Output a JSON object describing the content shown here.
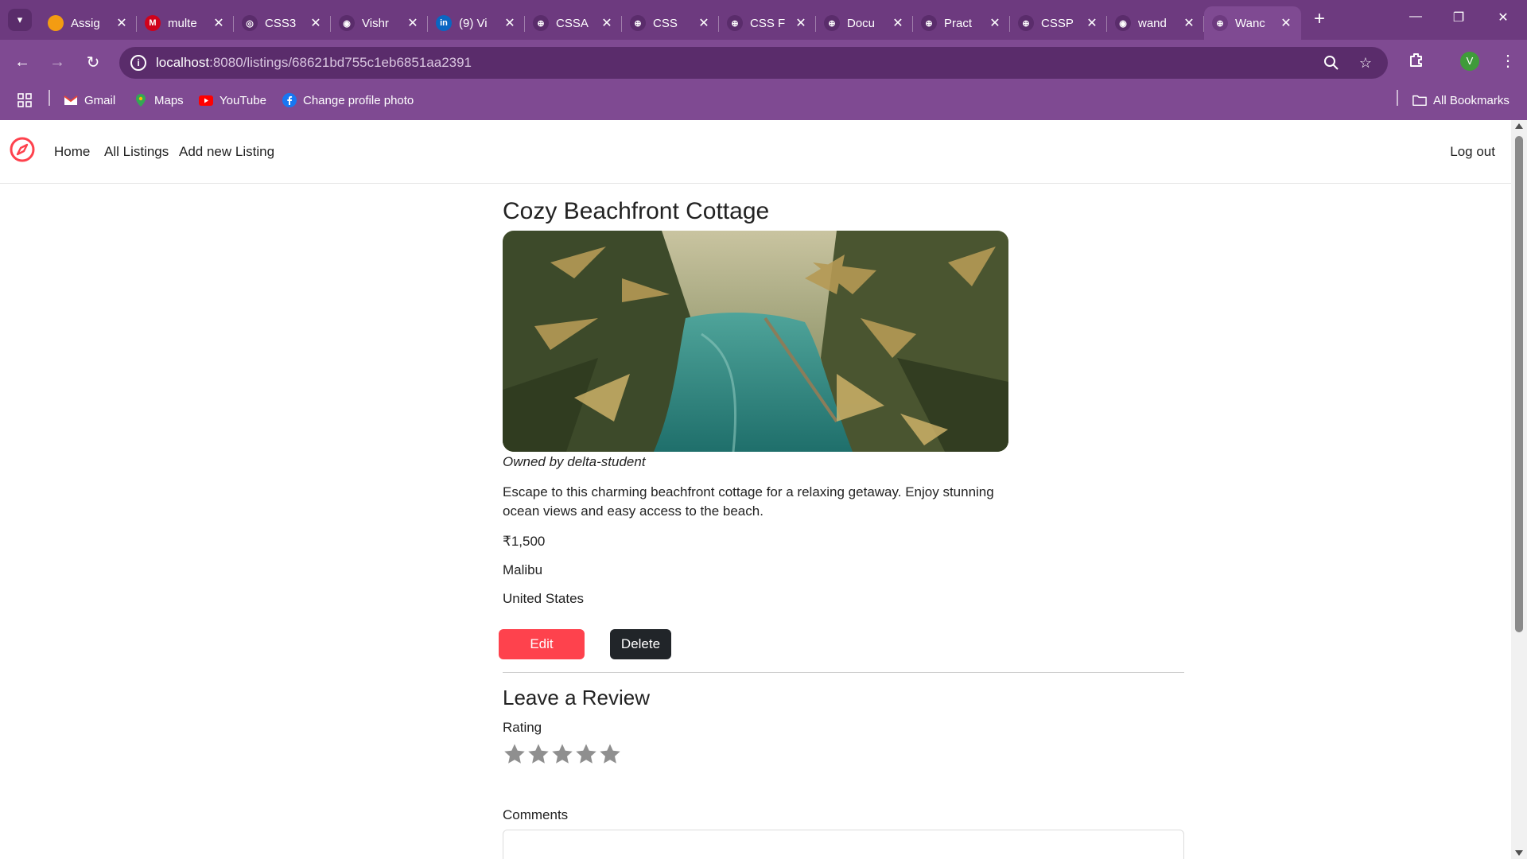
{
  "browser": {
    "tabs": [
      {
        "title": "Assig",
        "favicon": "assignment-icon",
        "fav_text": "",
        "fav_color": "#f39c12"
      },
      {
        "title": "multe",
        "favicon": "multe-icon",
        "fav_text": "M",
        "fav_color": "#d0021b"
      },
      {
        "title": "CSS3",
        "favicon": "chatgpt-icon",
        "fav_text": "◎",
        "fav_color": "#5a2c6b"
      },
      {
        "title": "Vishr",
        "favicon": "github-icon",
        "fav_text": "◉",
        "fav_color": "#5a2c6b"
      },
      {
        "title": "(9) Vi",
        "favicon": "linkedin-icon",
        "fav_text": "in",
        "fav_color": "#0a66c2"
      },
      {
        "title": "CSSA",
        "favicon": "globe-icon",
        "fav_text": "⊕",
        "fav_color": "#5a2c6b"
      },
      {
        "title": "CSS",
        "favicon": "globe-icon",
        "fav_text": "⊕",
        "fav_color": "#5a2c6b"
      },
      {
        "title": "CSS F",
        "favicon": "globe-icon",
        "fav_text": "⊕",
        "fav_color": "#5a2c6b"
      },
      {
        "title": "Docu",
        "favicon": "globe-icon",
        "fav_text": "⊕",
        "fav_color": "#5a2c6b"
      },
      {
        "title": "Pract",
        "favicon": "globe-icon",
        "fav_text": "⊕",
        "fav_color": "#5a2c6b"
      },
      {
        "title": "CSSP",
        "favicon": "globe-icon",
        "fav_text": "⊕",
        "fav_color": "#5a2c6b"
      },
      {
        "title": "wand",
        "favicon": "github-icon",
        "fav_text": "◉",
        "fav_color": "#5a2c6b"
      },
      {
        "title": "Wanc",
        "favicon": "globe-icon",
        "fav_text": "⊕",
        "fav_color": "#6d3a7f",
        "active": true
      }
    ],
    "url_host": "localhost",
    "url_path": ":8080/listings/68621bd755c1eb6851aa2391",
    "profile_initial": "V",
    "bookmarks": {
      "gmail": "Gmail",
      "maps": "Maps",
      "youtube": "YouTube",
      "profile_photo": "Change profile photo",
      "all": "All Bookmarks"
    },
    "theme_color": "#7f4a92"
  },
  "site": {
    "nav": {
      "home": "Home",
      "all_listings": "All Listings",
      "add_listing": "Add new Listing",
      "logout": "Log out"
    },
    "brand_color": "#fe424d"
  },
  "listing": {
    "title": "Cozy Beachfront Cottage",
    "owner": "Owned by delta-student",
    "description": "Escape to this charming beachfront cottage for a relaxing getaway. Enjoy stunning ocean views and easy access to the beach.",
    "price": "₹1,500",
    "location": "Malibu",
    "country": "United States",
    "edit_label": "Edit",
    "delete_label": "Delete"
  },
  "review": {
    "heading": "Leave a Review",
    "rating_label": "Rating",
    "rating_value": 0,
    "rating_max": 5,
    "comments_label": "Comments"
  }
}
